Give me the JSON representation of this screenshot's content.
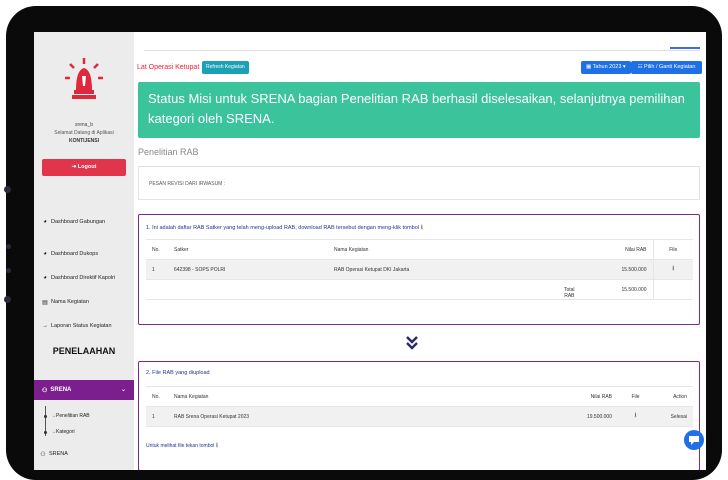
{
  "sidebar": {
    "user_name": "srena_b",
    "welcome": "Selamat Datang di Aplikasi",
    "app_name": "KONTIJENSI",
    "logout_label": "Logout",
    "items": [
      {
        "label": "Dashboard Gabungan",
        "icon": "dashboard-icon"
      },
      {
        "label": "Dashboard Dukops",
        "icon": "dashboard-icon"
      },
      {
        "label": "Dashboard Direktif Kapolri",
        "icon": "dashboard-icon"
      },
      {
        "label": "Nama Kegiatan",
        "icon": "list-icon"
      },
      {
        "label": "Laporan Status Kegiatan",
        "icon": "arrow-right-icon"
      }
    ],
    "section_title": "PENELAAHAN",
    "active_group": "SRENA",
    "sub_items": [
      "Penelitian RAB",
      "Kategori"
    ],
    "collapsed_group": "SRENA"
  },
  "header": {
    "breadcrumb": "Lat Operasi Ketupat",
    "refresh_label": "Refresh Kegiatan",
    "year_label": "Tahun 2023",
    "pick_label": "Pilih / Ganti Kegiatan"
  },
  "alert": {
    "message": "Status Misi untuk SRENA bagian Penelitian RAB berhasil diselesaikan, selanjutnya pemilihan kategori oleh SRENA."
  },
  "subheading": "Penelitian RAB",
  "revisi_label": "PESAN REVISI DARI IRWASUM :",
  "panel1": {
    "title": "1. Ini adalah daftar RAB Satker yang telah meng-upload RAB, download RAB tersebut dengan meng-klik tombol",
    "headers": {
      "no": "No.",
      "satker": "Satker",
      "nama": "Nama Kegiatan",
      "nilai": "Nilai RAB",
      "file": "File"
    },
    "rows": [
      {
        "no": "1",
        "satker": "642398 - SOPS POLRI",
        "nama": "RAB Operasi Ketupat DKI Jakarta",
        "nilai": "15.500.000"
      }
    ],
    "total_label": "Total RAB",
    "total_value": "15.500.000"
  },
  "panel2": {
    "title": "2. File RAB yang diupload",
    "headers": {
      "no": "No.",
      "nama": "Nama Kegiatan",
      "nilai": "Nilai RAB",
      "file": "File",
      "action": "Action"
    },
    "rows": [
      {
        "no": "1",
        "nama": "RAB Srena Operasi Ketupat 2023",
        "nilai": "19.500.000",
        "action": "Selesai"
      }
    ],
    "note": "Untuk melihat file tekan tombol"
  },
  "colors": {
    "alert": "#3bc49b",
    "active_nav": "#7b1e8e",
    "logout": "#e0354a",
    "primary": "#1f6fe6",
    "info": "#1aa1b5"
  }
}
